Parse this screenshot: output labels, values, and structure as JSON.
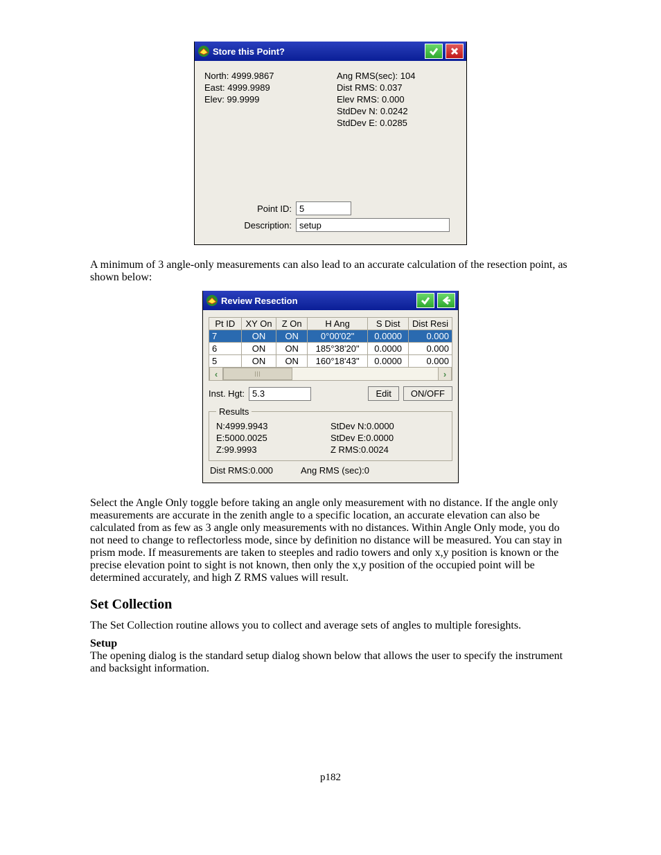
{
  "dialog1": {
    "title": "Store this Point?",
    "north": "North: 4999.9867",
    "east": "East: 4999.9989",
    "elev": "Elev: 99.9999",
    "ang_rms": "Ang RMS(sec): 104",
    "dist_rms": "Dist RMS: 0.037",
    "elev_rms": "Elev RMS: 0.000",
    "stddev_n": "StdDev N: 0.0242",
    "stddev_e": "StdDev E: 0.0285",
    "point_id_label": "Point ID:",
    "point_id_value": "5",
    "description_label": "Description:",
    "description_value": "setup"
  },
  "para1": "A minimum of 3 angle-only measurements can also lead to an accurate calculation of the resection point, as shown below:",
  "dialog2": {
    "title": "Review Resection",
    "headers": [
      "Pt ID",
      "XY On",
      "Z On",
      "H Ang",
      "S Dist",
      "Dist Resi"
    ],
    "rows": [
      {
        "ptid": "7",
        "xy": "ON",
        "z": "ON",
        "hang": "0°00'02\"",
        "sdist": "0.0000",
        "dres": "0.000",
        "selected": true
      },
      {
        "ptid": "6",
        "xy": "ON",
        "z": "ON",
        "hang": "185°38'20\"",
        "sdist": "0.0000",
        "dres": "0.000",
        "selected": false
      },
      {
        "ptid": "5",
        "xy": "ON",
        "z": "ON",
        "hang": "160°18'43\"",
        "sdist": "0.0000",
        "dres": "0.000",
        "selected": false
      }
    ],
    "inst_hgt_label": "Inst. Hgt:",
    "inst_hgt_value": "5.3",
    "edit_label": "Edit",
    "onoff_label": "ON/OFF",
    "results_legend": "Results",
    "res_n": "N:4999.9943",
    "res_e": "E:5000.0025",
    "res_z": "Z:99.9993",
    "stdev_n": "StDev N:0.0000",
    "stdev_e": "StDev E:0.0000",
    "zrms": "Z RMS:0.0024",
    "dist_rms": "Dist RMS:0.000",
    "ang_rms": "Ang RMS (sec):0"
  },
  "para2": "Select the Angle Only toggle before taking an angle only measurement with no distance.  If the angle only measurements are accurate in the zenith angle to a specific location, an accurate elevation can also be calculated from as few as 3 angle only measurements with no distances.  Within Angle Only mode, you do not need to change to reflectorless mode, since by definition no distance will be measured.  You can stay in prism mode.  If measurements are taken to steeples and radio towers and only x,y position is known or the precise elevation point to sight is not known, then only the x,y position of the occupied point will be determined accurately, and high Z RMS values will result.",
  "heading": "Set Collection",
  "para3": "The Set Collection routine allows you to collect and average sets of angles to multiple foresights.",
  "setup_label": "Setup",
  "para4": "The opening dialog is the standard setup dialog shown below that allows the user to specify the instrument and backsight information.",
  "page_number": "p182"
}
